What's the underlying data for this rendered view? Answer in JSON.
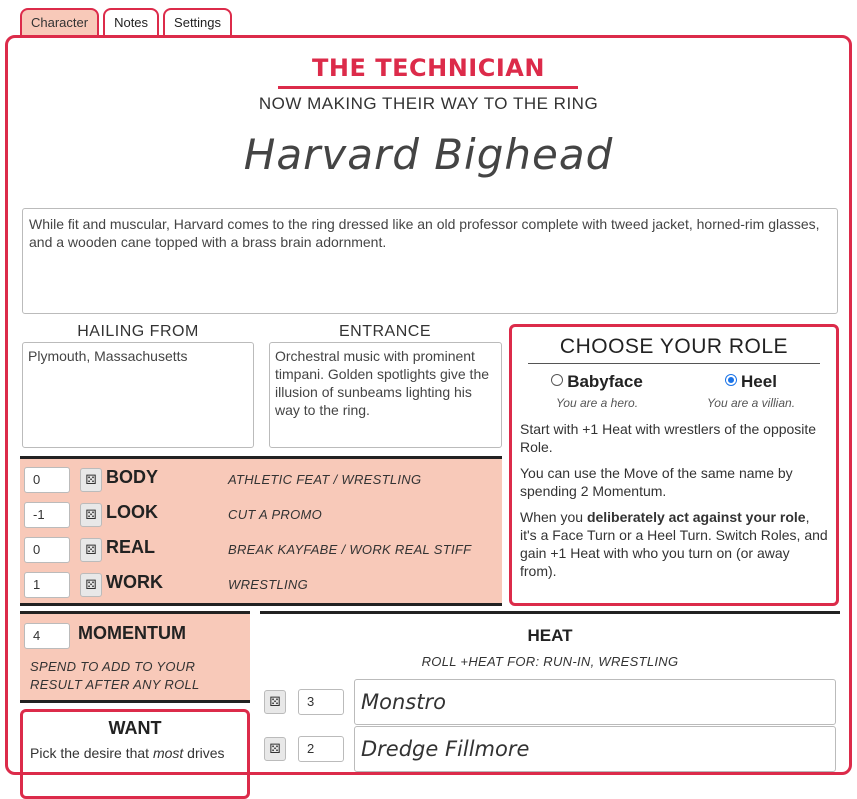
{
  "tabs": [
    {
      "label": "Character",
      "active": true
    },
    {
      "label": "Notes",
      "active": false
    },
    {
      "label": "Settings",
      "active": false
    }
  ],
  "header": {
    "playbook": "THE TECHNICIAN",
    "tagline": "NOW MAKING THEIR WAY TO THE RING",
    "character_name": "Harvard Bighead"
  },
  "description": "While fit and muscular, Harvard comes to the ring dressed like an old professor complete with tweed jacket, horned-rim glasses, and a wooden cane topped with a brass brain adornment.",
  "hailing_from": {
    "label": "HAILING FROM",
    "value": "Plymouth, Massachusetts"
  },
  "entrance": {
    "label": "ENTRANCE",
    "value": "Orchestral music with prominent timpani. Golden spotlights give the illusion of sunbeams lighting his way to the ring."
  },
  "stats": [
    {
      "value": "0",
      "name": "BODY",
      "moves": "ATHLETIC FEAT / WRESTLING"
    },
    {
      "value": "-1",
      "name": "LOOK",
      "moves": "CUT A PROMO"
    },
    {
      "value": "0",
      "name": "REAL",
      "moves": "BREAK KAYFABE / WORK REAL STIFF"
    },
    {
      "value": "1",
      "name": "WORK",
      "moves": "WRESTLING"
    }
  ],
  "role": {
    "title": "CHOOSE YOUR ROLE",
    "options": [
      {
        "label": "Babyface",
        "hint": "You are a hero.",
        "selected": false
      },
      {
        "label": "Heel",
        "hint": "You are a villian.",
        "selected": true
      }
    ],
    "p1": "Start with +1 Heat with wrestlers of the opposite Role.",
    "p2": "You can use the Move of the same name by spending 2 Momentum.",
    "p3_pre": "When you ",
    "p3_bold": "deliberately act against your role",
    "p3_post": ", it's a Face Turn or a Heel Turn. Switch Roles, and gain +1 Heat with who you turn on (or away from)."
  },
  "momentum": {
    "value": "4",
    "title": "MOMENTUM",
    "hint": "SPEND TO ADD TO YOUR RESULT AFTER ANY ROLL"
  },
  "want": {
    "title": "WANT",
    "text_pre": "Pick the desire that ",
    "text_em": "most",
    "text_post": " drives"
  },
  "heat": {
    "title": "HEAT",
    "hint": "ROLL +HEAT FOR: RUN-IN, WRESTLING",
    "rows": [
      {
        "value": "3",
        "name": "Monstro"
      },
      {
        "value": "2",
        "name": "Dredge Fillmore"
      }
    ]
  },
  "icons": {
    "die": "die-icon"
  },
  "colors": {
    "accent": "#dc2b4a",
    "panel": "#f8c9b9",
    "radio": "#1a73e8"
  }
}
